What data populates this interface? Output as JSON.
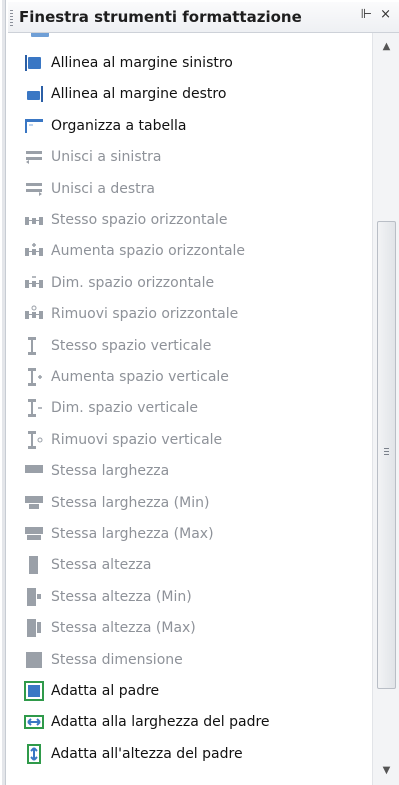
{
  "window": {
    "title": "Finestra strumenti formattazione",
    "pin_glyph": "⊩ ×"
  },
  "colors": {
    "enabled_icon": "#3a77c4",
    "disabled_icon": "#9aa0a8",
    "green_icon": "#2f9a4a"
  },
  "items": [
    {
      "label": "Allinea al margine sinistro",
      "enabled": true,
      "icon": "align-left-icon"
    },
    {
      "label": "Allinea al margine destro",
      "enabled": true,
      "icon": "align-right-icon"
    },
    {
      "label": "Organizza a tabella",
      "enabled": true,
      "icon": "table-layout-icon"
    },
    {
      "label": "Unisci a sinistra",
      "enabled": false,
      "icon": "merge-left-icon"
    },
    {
      "label": "Unisci a destra",
      "enabled": false,
      "icon": "merge-right-icon"
    },
    {
      "label": "Stesso spazio orizzontale",
      "enabled": false,
      "icon": "equal-hspace-icon"
    },
    {
      "label": "Aumenta spazio orizzontale",
      "enabled": false,
      "icon": "increase-hspace-icon"
    },
    {
      "label": "Dim. spazio orizzontale",
      "enabled": false,
      "icon": "decrease-hspace-icon"
    },
    {
      "label": "Rimuovi spazio orizzontale",
      "enabled": false,
      "icon": "remove-hspace-icon"
    },
    {
      "label": "Stesso spazio verticale",
      "enabled": false,
      "icon": "equal-vspace-icon"
    },
    {
      "label": "Aumenta spazio verticale",
      "enabled": false,
      "icon": "increase-vspace-icon"
    },
    {
      "label": "Dim. spazio verticale",
      "enabled": false,
      "icon": "decrease-vspace-icon"
    },
    {
      "label": "Rimuovi spazio verticale",
      "enabled": false,
      "icon": "remove-vspace-icon"
    },
    {
      "label": "Stessa larghezza",
      "enabled": false,
      "icon": "same-width-icon"
    },
    {
      "label": "Stessa larghezza (Min)",
      "enabled": false,
      "icon": "same-width-min-icon"
    },
    {
      "label": "Stessa larghezza (Max)",
      "enabled": false,
      "icon": "same-width-max-icon"
    },
    {
      "label": "Stessa altezza",
      "enabled": false,
      "icon": "same-height-icon"
    },
    {
      "label": "Stessa altezza (Min)",
      "enabled": false,
      "icon": "same-height-min-icon"
    },
    {
      "label": "Stessa altezza (Max)",
      "enabled": false,
      "icon": "same-height-max-icon"
    },
    {
      "label": "Stessa dimensione",
      "enabled": false,
      "icon": "same-size-icon"
    },
    {
      "label": "Adatta al padre",
      "enabled": true,
      "icon": "fit-parent-icon"
    },
    {
      "label": "Adatta alla larghezza del padre",
      "enabled": true,
      "icon": "fit-parent-width-icon"
    },
    {
      "label": "Adatta all'altezza del padre",
      "enabled": true,
      "icon": "fit-parent-height-icon"
    }
  ],
  "scrollbar": {
    "up_glyph": "▲",
    "down_glyph": "▼"
  }
}
